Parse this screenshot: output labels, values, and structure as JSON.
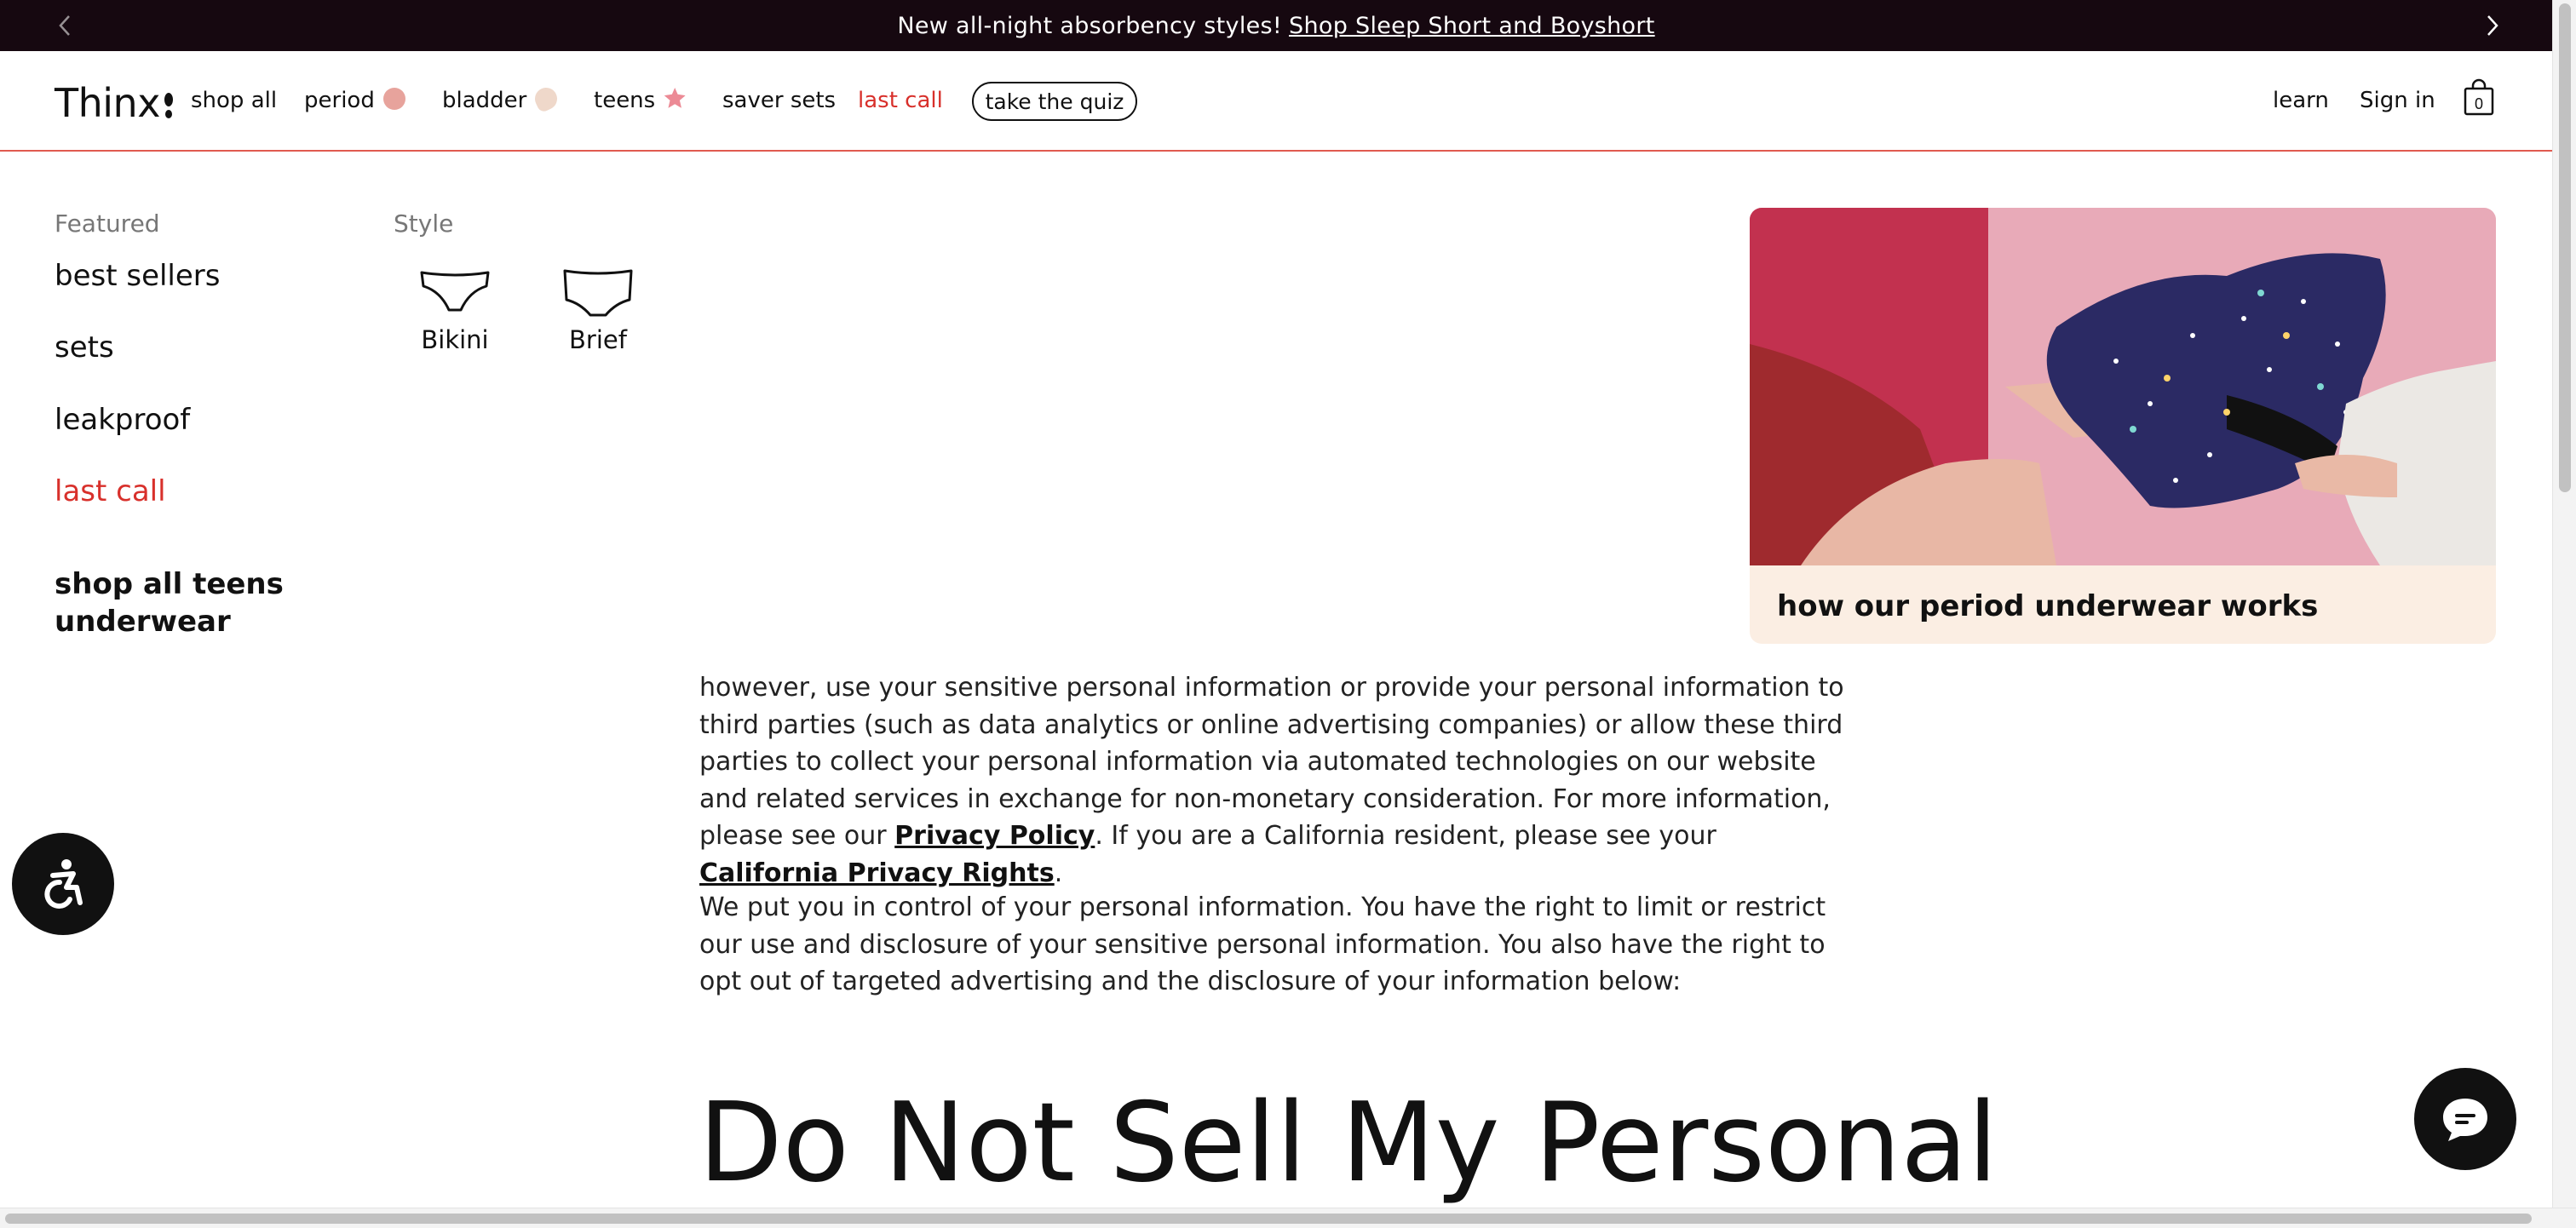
{
  "announcement": {
    "text": "New all-night absorbency styles!",
    "link": "Shop Sleep Short and Boyshort",
    "prev_icon": "chevron-left-icon",
    "next_icon": "chevron-right-icon"
  },
  "header": {
    "logo": "Thinx",
    "nav": [
      {
        "label": "shop all"
      },
      {
        "label": "period",
        "swatch": "#e7a39c"
      },
      {
        "label": "bladder",
        "swatch": "#efd8ca"
      },
      {
        "label": "teens",
        "swatch": "#ec8a95"
      },
      {
        "label": "saver sets"
      },
      {
        "label": "last call",
        "color": "#d8302b"
      }
    ],
    "quiz_button": "take the quiz",
    "learn": "learn",
    "sign_in": "Sign in",
    "cart_count": "0"
  },
  "mega_menu": {
    "featured_label": "Featured",
    "featured_links": [
      "best sellers",
      "sets",
      "leakproof",
      "last call"
    ],
    "shop_all": "shop all teens underwear",
    "style_label": "Style",
    "styles": [
      "Bikini",
      "Brief"
    ],
    "promo_caption": "how our period underwear works"
  },
  "content": {
    "p1_start": "however, use your sensitive personal information or provide your personal information to third parties (such as data analytics or online advertising companies) or allow these third parties to collect your personal information via automated technologies on our website and related services in exchange for non-monetary consideration. For more information, please see our ",
    "privacy_policy": "Privacy Policy",
    "p1_mid": ". If you are a California resident, please see your ",
    "california_rights": "California Privacy Rights",
    "p1_end": ".",
    "p2": "We put you in control of your personal information. You have the right to limit or restrict our use and disclosure of your sensitive personal information. You also have the right to opt out of targeted advertising and the disclosure of your information below:",
    "heading": "Do Not Sell My Personal"
  },
  "widgets": {
    "accessibility_icon": "accessibility-icon",
    "chat_icon": "chat-bubble-icon"
  }
}
